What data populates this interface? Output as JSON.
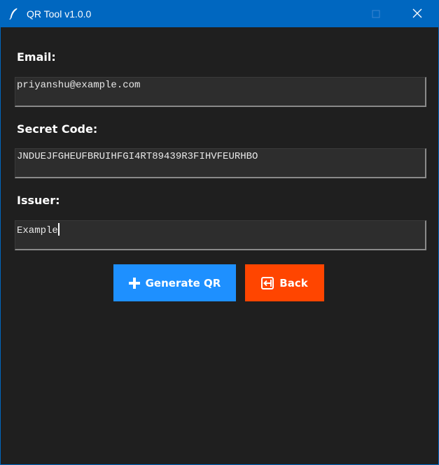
{
  "window": {
    "title": "QR Tool v1.0.0",
    "icons": {
      "app": "feather-icon",
      "minimize": "minimize-icon",
      "maximize": "maximize-icon",
      "close": "close-icon"
    },
    "colors": {
      "titlebar": "#0067c0",
      "background": "#1f1f1f"
    }
  },
  "form": {
    "email": {
      "label": "Email:",
      "value": "priyanshu@example.com"
    },
    "secret": {
      "label": "Secret Code:",
      "value": "JNDUEJFGHEUFBRUIHFGI4RT89439R3FIHVFEURHBO"
    },
    "issuer": {
      "label": "Issuer:",
      "value": "Example"
    }
  },
  "buttons": {
    "generate": {
      "label": "Generate QR",
      "icon": "plus-icon",
      "color": "#1e90ff"
    },
    "back": {
      "label": "Back",
      "icon": "back-arrow-icon",
      "color": "#ff4500"
    }
  }
}
